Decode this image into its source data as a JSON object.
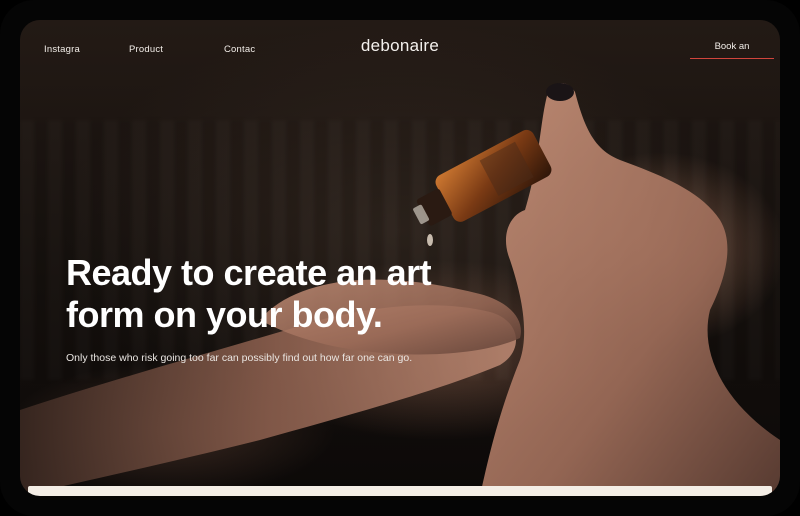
{
  "nav": {
    "links": [
      "Instagra",
      "Product",
      "Contac"
    ],
    "logo": "debonaire",
    "book_label": "Book an"
  },
  "hero": {
    "headline_line1": "Ready to create an art",
    "headline_line2": "form on your body.",
    "subtext": "Only those who risk going too far can possibly find out how far one can go."
  },
  "colors": {
    "accent_underline": "#d0453c",
    "text": "#ffffff",
    "background": "#120d0a",
    "footer_strip": "#f4eee6"
  },
  "icons": {
    "hero_image": "hand-with-oil-bottle-photo"
  }
}
